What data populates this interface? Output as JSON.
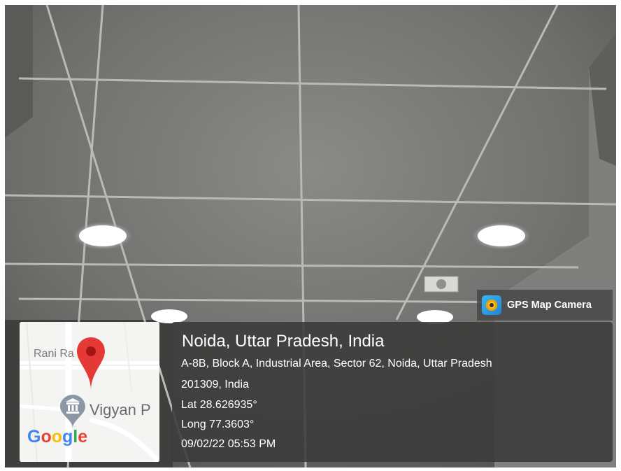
{
  "app_badge": {
    "icon": "gps-map-camera-icon",
    "name": "GPS Map Camera"
  },
  "location": {
    "title": "Noida, Uttar Pradesh, India",
    "address_line1": "A-8B, Block A, Industrial Area, Sector 62, Noida, Uttar Pradesh",
    "address_line2": "201309, India",
    "latitude": "Lat 28.626935°",
    "longitude": "Long 77.3603°",
    "timestamp": "09/02/22 05:53 PM"
  },
  "map": {
    "road_label": "Rani Ra  h Rd",
    "poi_label": "Vigyan P",
    "poi_icon": "museum-icon",
    "pin_icon": "location-pin-icon",
    "logo_letters": [
      "G",
      "o",
      "o",
      "g",
      "l",
      "e"
    ],
    "logo_colors": [
      "#4285F4",
      "#EA4335",
      "#FBBC05",
      "#4285F4",
      "#34A853",
      "#EA4335"
    ],
    "pin_color": "#e53935"
  },
  "colors": {
    "panel_bg": "#3a3a3a",
    "text": "#ffffff"
  }
}
